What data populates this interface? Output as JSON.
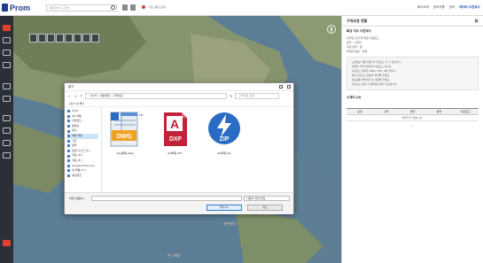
{
  "app": {
    "name": "Prom",
    "search_placeholder": "통합검색 (도로명)"
  },
  "top_chip": "지도 통합 검색",
  "top_menu": [
    "회사소개",
    "공지사항",
    "공지",
    "데이터 다운로드"
  ],
  "map": {
    "labels": [
      "대한해협",
      "한국해협"
    ]
  },
  "right_panel": {
    "title": "구역요청 현황",
    "section_title": "특성 지도 다운로드",
    "lines": [
      "인터넷 조회 및 파일 다운로드",
      "필지 : 수질지",
      "지정 면적 : 원",
      "데이터 분류 : 전체"
    ],
    "notes": [
      "· 도면정보 내용 작성 후 다운로드 할 수 있습니다.",
      "· 선택한 구역 데이터만 다운로드 합니다.",
      "· 다운로드 형식은 DWG, DXF, ZIP 입니다.",
      "· 최대 다운로드 용량을 확인해 주세요.",
      "· 좌표계를 확인하신 후 사용해 주세요.",
      "· 다운로드 완료 후 목록에서 확인 가능합니다."
    ],
    "table_title": "소재지 (0)",
    "columns": [
      "순번",
      "구역",
      "면적",
      "상태",
      "다운로드"
    ],
    "empty": "데이터가 없습니다.",
    "pager": "〈  〉"
  },
  "dialog": {
    "title": "열기",
    "path": "› 내 PC › 바탕화면 › 구역자료 ›",
    "search_placeholder": "구역자료 검색",
    "command": "구성 ▾    새 폴더",
    "nav_items": [
      "내 PC",
      "3D 개체",
      "다운로드",
      "동영상",
      "문서",
      "바탕 화면",
      "사진",
      "음악",
      "로컬 디스크 (C:)",
      "자료 (D:)",
      "자료 (E:)",
      "Google Drive (G:)",
      "새 볼륨 (H:)",
      "네트워크"
    ],
    "selected_nav": 5,
    "files": [
      {
        "name": "dwg파일.dwg",
        "label": "DWG"
      },
      {
        "name": "dxf파일.dxf",
        "label": "DXF"
      },
      {
        "name": "zip파일.zip",
        "label": "ZIP"
      }
    ],
    "filename_label": "파일 이름(N):",
    "filetype": "사용자 지정 파일",
    "open_button": "열기(O)",
    "cancel_button": "취소"
  },
  "colors": {
    "brand": "#1d3d8f",
    "dwg": "#f0a322",
    "dxf": "#c3213a",
    "zip": "#2a6bc4",
    "sidebar": "#2b2f36",
    "accent": "#e2412f"
  }
}
